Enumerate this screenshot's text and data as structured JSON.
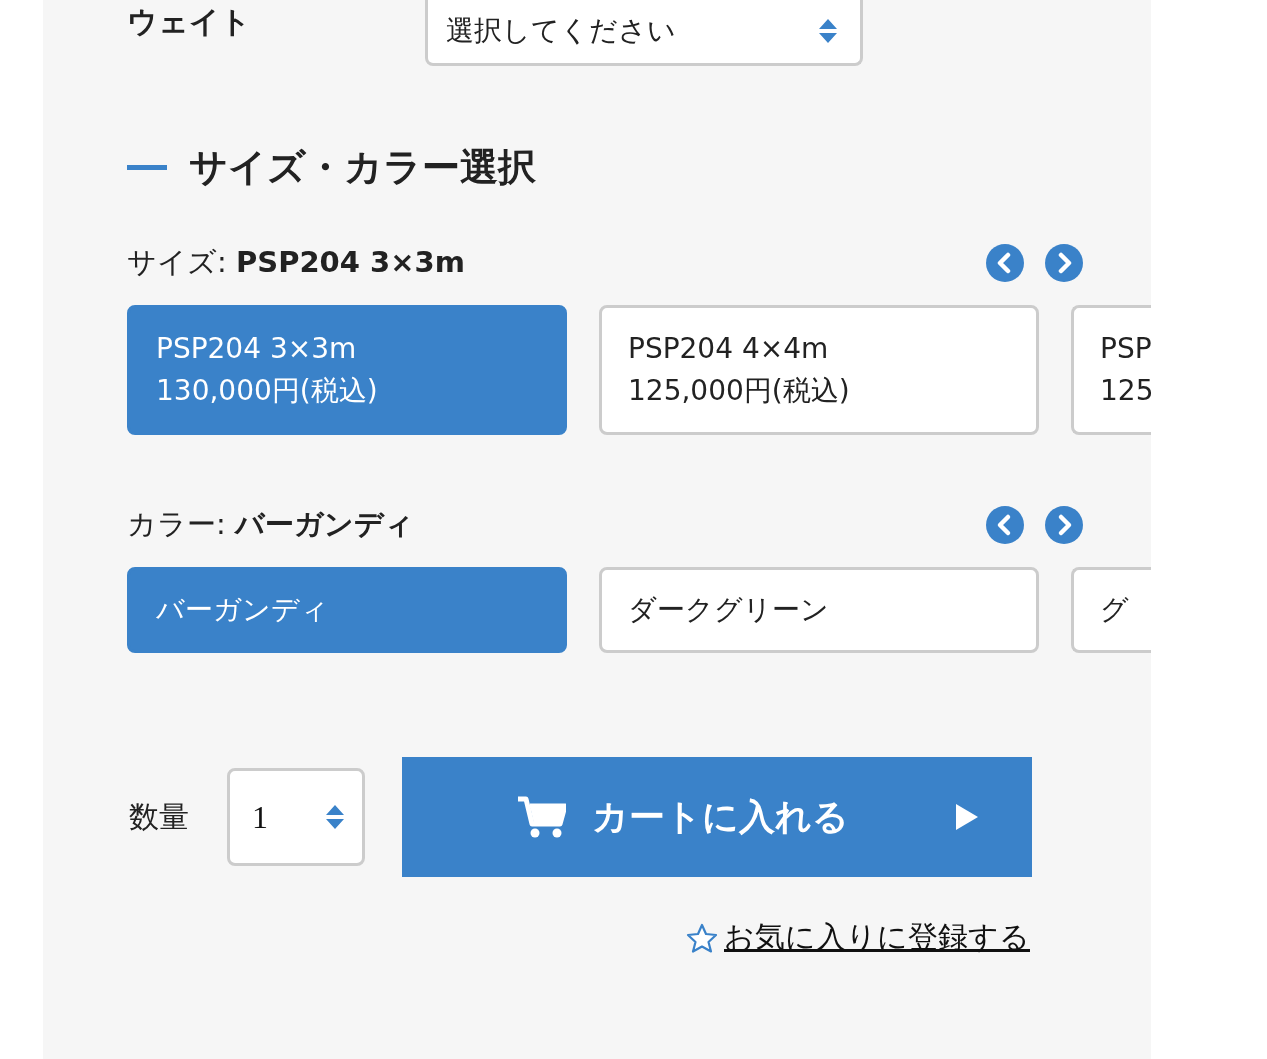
{
  "weight": {
    "label": "ウェイト",
    "value": "選択してください"
  },
  "heading": "サイズ・カラー選択",
  "size": {
    "label": "サイズ:",
    "value": "PSP204 3×3m",
    "options": [
      {
        "name": "PSP204 3×3m",
        "price": "130,000円(税込)",
        "selected": true
      },
      {
        "name": "PSP204 4×4m",
        "price": "125,000円(税込)",
        "selected": false
      },
      {
        "name": "PSP",
        "price": "125",
        "selected": false
      }
    ]
  },
  "color": {
    "label": "カラー:",
    "value": "バーガンディ",
    "options": [
      {
        "name": "バーガンディ",
        "selected": true
      },
      {
        "name": "ダークグリーン",
        "selected": false
      },
      {
        "name": "グ",
        "selected": false
      }
    ]
  },
  "quantity": {
    "label": "数量",
    "value": "1"
  },
  "cart_button": "カートに入れる",
  "favorite_link": "お気に入りに登録する"
}
